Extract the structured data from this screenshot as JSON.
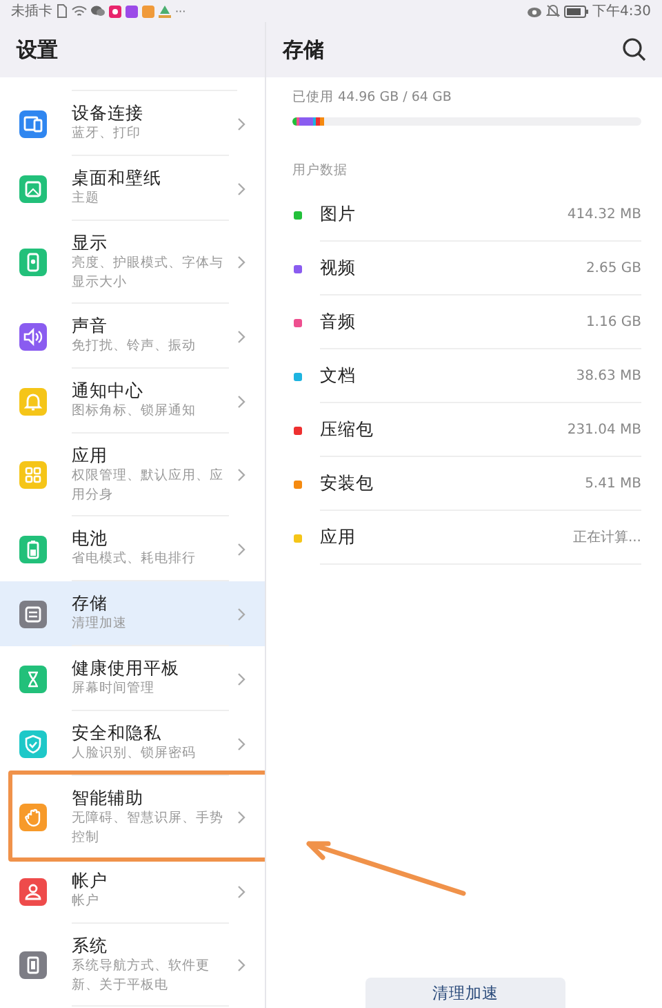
{
  "status_bar": {
    "carrier": "未插卡",
    "overflow": "···",
    "time": "下午4:30"
  },
  "settings": {
    "title": "设置",
    "items": [
      {
        "title": "设备连接",
        "subtitle": "蓝牙、打印",
        "color": "#2f86f0",
        "selected": false,
        "highlighted": false
      },
      {
        "title": "桌面和壁纸",
        "subtitle": "主题",
        "color": "#22c07a",
        "selected": false,
        "highlighted": false
      },
      {
        "title": "显示",
        "subtitle": "亮度、护眼模式、字体与显示大小",
        "color": "#22c07a",
        "selected": false,
        "highlighted": false
      },
      {
        "title": "声音",
        "subtitle": "免打扰、铃声、振动",
        "color": "#8a5cf0",
        "selected": false,
        "highlighted": false
      },
      {
        "title": "通知中心",
        "subtitle": "图标角标、锁屏通知",
        "color": "#f5c518",
        "selected": false,
        "highlighted": false
      },
      {
        "title": "应用",
        "subtitle": "权限管理、默认应用、应用分身",
        "color": "#f5c518",
        "selected": false,
        "highlighted": false
      },
      {
        "title": "电池",
        "subtitle": "省电模式、耗电排行",
        "color": "#22c07a",
        "selected": false,
        "highlighted": false
      },
      {
        "title": "存储",
        "subtitle": "清理加速",
        "color": "#7d7d85",
        "selected": true,
        "highlighted": false
      },
      {
        "title": "健康使用平板",
        "subtitle": "屏幕时间管理",
        "color": "#22c07a",
        "selected": false,
        "highlighted": false
      },
      {
        "title": "安全和隐私",
        "subtitle": "人脸识别、锁屏密码",
        "color": "#1ec8c8",
        "selected": false,
        "highlighted": false
      },
      {
        "title": "智能辅助",
        "subtitle": "无障碍、智慧识屏、手势控制",
        "color": "#f79a2a",
        "selected": false,
        "highlighted": true
      },
      {
        "title": "帐户",
        "subtitle": "帐户",
        "color": "#ee4b4b",
        "selected": false,
        "highlighted": false
      },
      {
        "title": "系统",
        "subtitle": "系统导航方式、软件更新、关于平板电",
        "color": "#7d7d85",
        "selected": false,
        "highlighted": false
      }
    ]
  },
  "storage": {
    "title": "存储",
    "used": "已使用 44.96 GB / 64 GB",
    "usage_bar": {
      "level": 0.092
    },
    "section": "用户数据",
    "categories": [
      {
        "label": "图片",
        "value": "414.32 MB",
        "color": "#22c03a"
      },
      {
        "label": "视频",
        "value": "2.65 GB",
        "color": "#8a5cf0"
      },
      {
        "label": "音频",
        "value": "1.16 GB",
        "color": "#ee4f8f"
      },
      {
        "label": "文档",
        "value": "38.63 MB",
        "color": "#1eb4e0"
      },
      {
        "label": "压缩包",
        "value": "231.04 MB",
        "color": "#ee3030"
      },
      {
        "label": "安装包",
        "value": "5.41 MB",
        "color": "#f58a10"
      },
      {
        "label": "应用",
        "value": "正在计算...",
        "color": "#f5c518"
      }
    ],
    "button": "清理加速"
  },
  "annotation": {
    "arrow": true
  }
}
